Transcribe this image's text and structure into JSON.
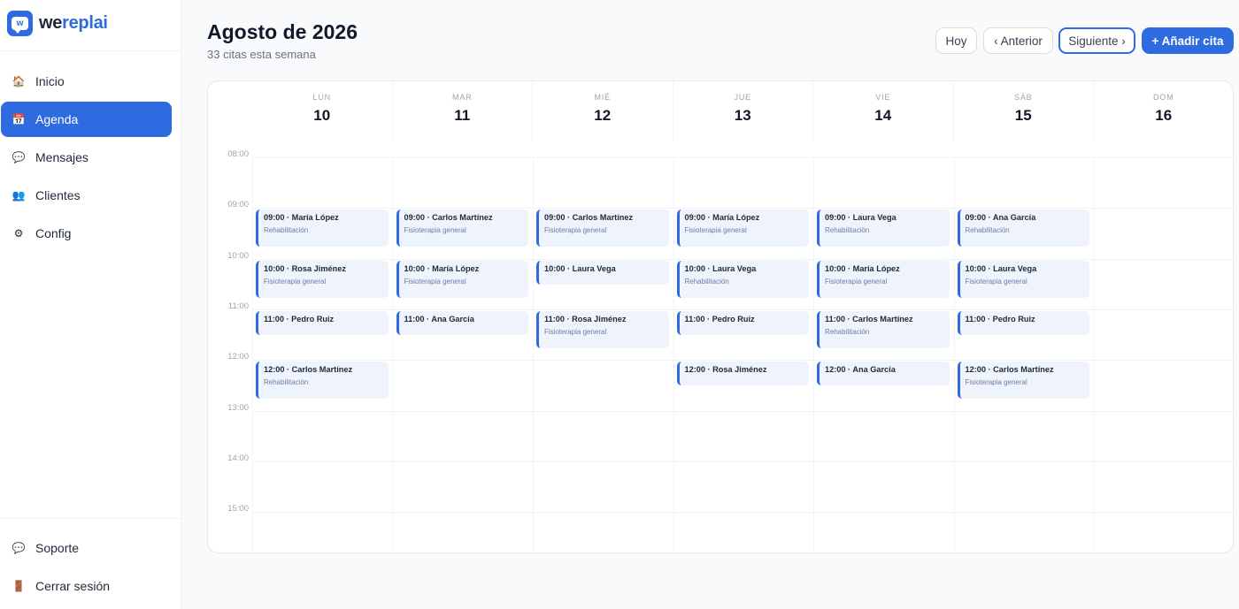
{
  "brand": {
    "logo_letter": "w",
    "name_start": "we",
    "name_accent": "replai",
    "primary_color": "#2f6be0"
  },
  "nav": {
    "items": [
      {
        "label": "Inicio",
        "icon": "house-icon",
        "glyph": "🏠",
        "active": false
      },
      {
        "label": "Agenda",
        "icon": "calendar-icon",
        "glyph": "📅",
        "active": true
      },
      {
        "label": "Mensajes",
        "icon": "chat-bubble-icon",
        "glyph": "💬",
        "active": false
      },
      {
        "label": "Clientes",
        "icon": "users-icon",
        "glyph": "👥",
        "active": false
      },
      {
        "label": "Config",
        "icon": "gear-icon",
        "glyph": "⚙",
        "active": false
      }
    ],
    "bottom": [
      {
        "label": "Soporte",
        "icon": "chat-bubble-icon",
        "glyph": "💬"
      },
      {
        "label": "Cerrar sesión",
        "icon": "door-icon",
        "glyph": "🚪"
      }
    ]
  },
  "header": {
    "title": "Agosto de 2026",
    "subtitle": "33 citas esta semana",
    "today_label": "Hoy",
    "prev_label": "‹ Anterior",
    "next_label": "Siguiente ›",
    "add_label": "+ Añadir cita"
  },
  "calendar": {
    "days": [
      {
        "name": "LUN",
        "num": "10"
      },
      {
        "name": "MAR",
        "num": "11"
      },
      {
        "name": "MIÉ",
        "num": "12"
      },
      {
        "name": "JUE",
        "num": "13"
      },
      {
        "name": "VIE",
        "num": "14"
      },
      {
        "name": "SÁB",
        "num": "15"
      },
      {
        "name": "DOM",
        "num": "16"
      }
    ],
    "hours": [
      "08:00",
      "09:00",
      "10:00",
      "11:00",
      "12:00",
      "13:00",
      "14:00",
      "15:00"
    ],
    "appointments": [
      {
        "day": 0,
        "start": "09:00",
        "title": "09:00 · María López",
        "service": "Rehabilitación"
      },
      {
        "day": 0,
        "start": "10:00",
        "title": "10:00 · Rosa Jiménez",
        "service": "Fisioterapia general"
      },
      {
        "day": 0,
        "start": "11:00",
        "title": "11:00 · Pedro Ruiz",
        "service": ""
      },
      {
        "day": 0,
        "start": "12:00",
        "title": "12:00 · Carlos Martínez",
        "service": "Rehabilitación"
      },
      {
        "day": 1,
        "start": "09:00",
        "title": "09:00 · Carlos Martínez",
        "service": "Fisioterapia general"
      },
      {
        "day": 1,
        "start": "10:00",
        "title": "10:00 · María López",
        "service": "Fisioterapia general"
      },
      {
        "day": 1,
        "start": "11:00",
        "title": "11:00 · Ana García",
        "service": ""
      },
      {
        "day": 2,
        "start": "09:00",
        "title": "09:00 · Carlos Martínez",
        "service": "Fisioterapia general"
      },
      {
        "day": 2,
        "start": "10:00",
        "title": "10:00 · Laura Vega",
        "service": ""
      },
      {
        "day": 2,
        "start": "11:00",
        "title": "11:00 · Rosa Jiménez",
        "service": "Fisioterapia general"
      },
      {
        "day": 3,
        "start": "09:00",
        "title": "09:00 · María López",
        "service": "Fisioterapia general"
      },
      {
        "day": 3,
        "start": "10:00",
        "title": "10:00 · Laura Vega",
        "service": "Rehabilitación"
      },
      {
        "day": 3,
        "start": "11:00",
        "title": "11:00 · Pedro Ruiz",
        "service": ""
      },
      {
        "day": 3,
        "start": "12:00",
        "title": "12:00 · Rosa Jiménez",
        "service": ""
      },
      {
        "day": 4,
        "start": "09:00",
        "title": "09:00 · Laura Vega",
        "service": "Rehabilitación"
      },
      {
        "day": 4,
        "start": "10:00",
        "title": "10:00 · María López",
        "service": "Fisioterapia general"
      },
      {
        "day": 4,
        "start": "11:00",
        "title": "11:00 · Carlos Martínez",
        "service": "Rehabilitación"
      },
      {
        "day": 4,
        "start": "12:00",
        "title": "12:00 · Ana García",
        "service": ""
      },
      {
        "day": 5,
        "start": "09:00",
        "title": "09:00 · Ana García",
        "service": "Rehabilitación"
      },
      {
        "day": 5,
        "start": "10:00",
        "title": "10:00 · Laura Vega",
        "service": "Fisioterapia general"
      },
      {
        "day": 5,
        "start": "11:00",
        "title": "11:00 · Pedro Ruiz",
        "service": ""
      },
      {
        "day": 5,
        "start": "12:00",
        "title": "12:00 · Carlos Martínez",
        "service": "Fisioterapia general"
      }
    ]
  }
}
